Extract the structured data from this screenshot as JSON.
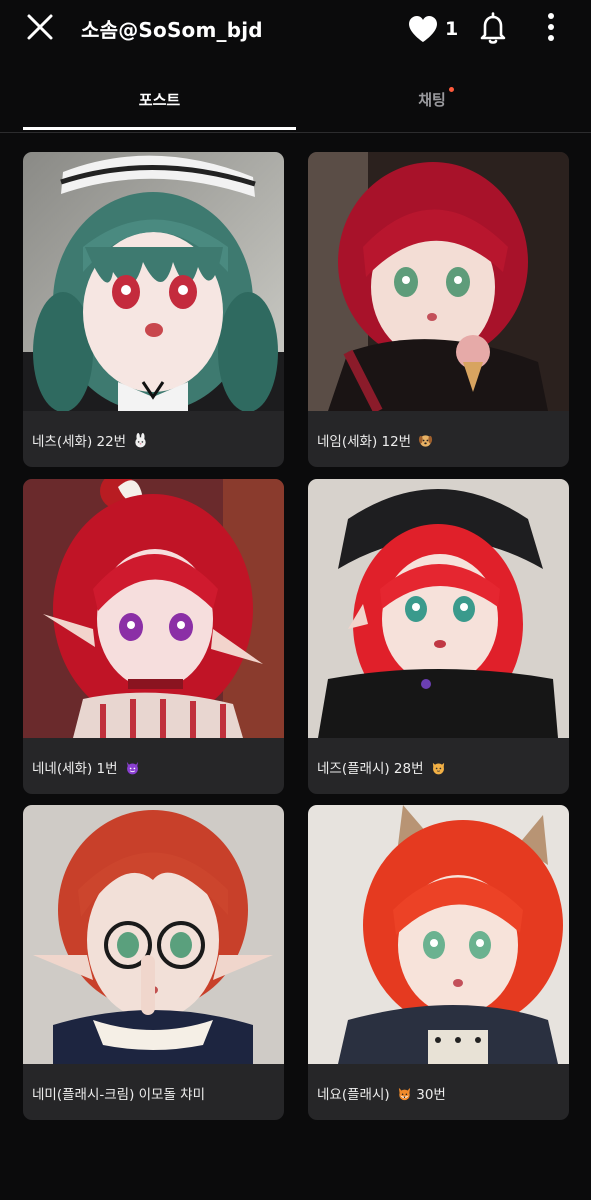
{
  "header": {
    "title": "소솜@SoSom_bjd",
    "like_count": "1"
  },
  "tabs": [
    {
      "label": "포스트",
      "active": true
    },
    {
      "label": "채팅",
      "active": false,
      "has_badge": true
    }
  ],
  "colors": {
    "background": "#0b0b0c",
    "card": "#262628",
    "badge": "#ff5a3c",
    "inactive_tab": "#9a9a9e"
  },
  "posts": [
    {
      "caption": "네츠(세화) 22번",
      "emoji": "rabbit-emoji"
    },
    {
      "caption": "네임(세화) 12번",
      "emoji": "dog-emoji"
    },
    {
      "caption": "네네(세화) 1번",
      "emoji": "devil-emoji"
    },
    {
      "caption": "네즈(플래시) 28번",
      "emoji": "cat-emoji"
    },
    {
      "caption": "네미(플래시-크림) 이모돌 챠미",
      "emoji": ""
    },
    {
      "caption": "네요(플래시)",
      "emoji": "fox-emoji",
      "caption_suffix": "30번"
    }
  ]
}
